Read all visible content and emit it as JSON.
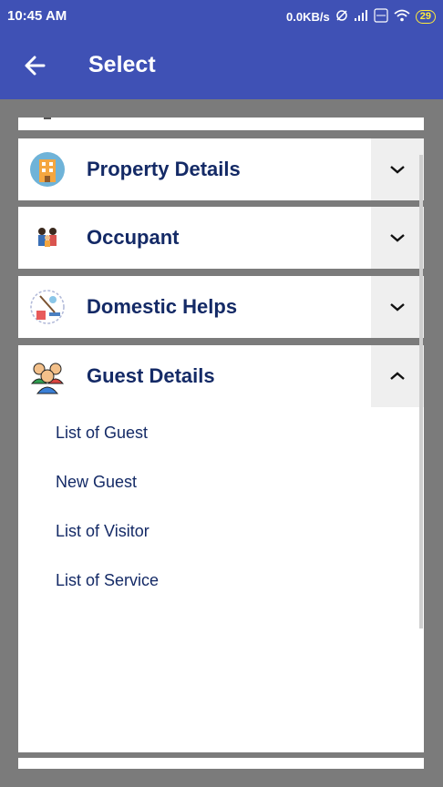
{
  "status": {
    "time": "10:45 AM",
    "speed": "0.0KB/s",
    "battery": "29"
  },
  "appbar": {
    "title": "Select"
  },
  "rows": [
    {
      "label": "Property Details",
      "icon": "building-icon",
      "chevron": "chevron-down-icon"
    },
    {
      "label": "Occupant",
      "icon": "family-icon",
      "chevron": "chevron-down-icon"
    },
    {
      "label": "Domestic Helps",
      "icon": "cleaning-tools-icon",
      "chevron": "chevron-down-icon"
    },
    {
      "label": "Guest Details",
      "icon": "guests-group-icon",
      "chevron": "chevron-up-icon"
    }
  ],
  "guest_menu": [
    "List of Guest",
    "New Guest",
    "List of Visitor",
    "List of Service"
  ],
  "colors": {
    "primary": "#3f51b5",
    "label": "#142a66",
    "background": "#7b7b7b"
  }
}
